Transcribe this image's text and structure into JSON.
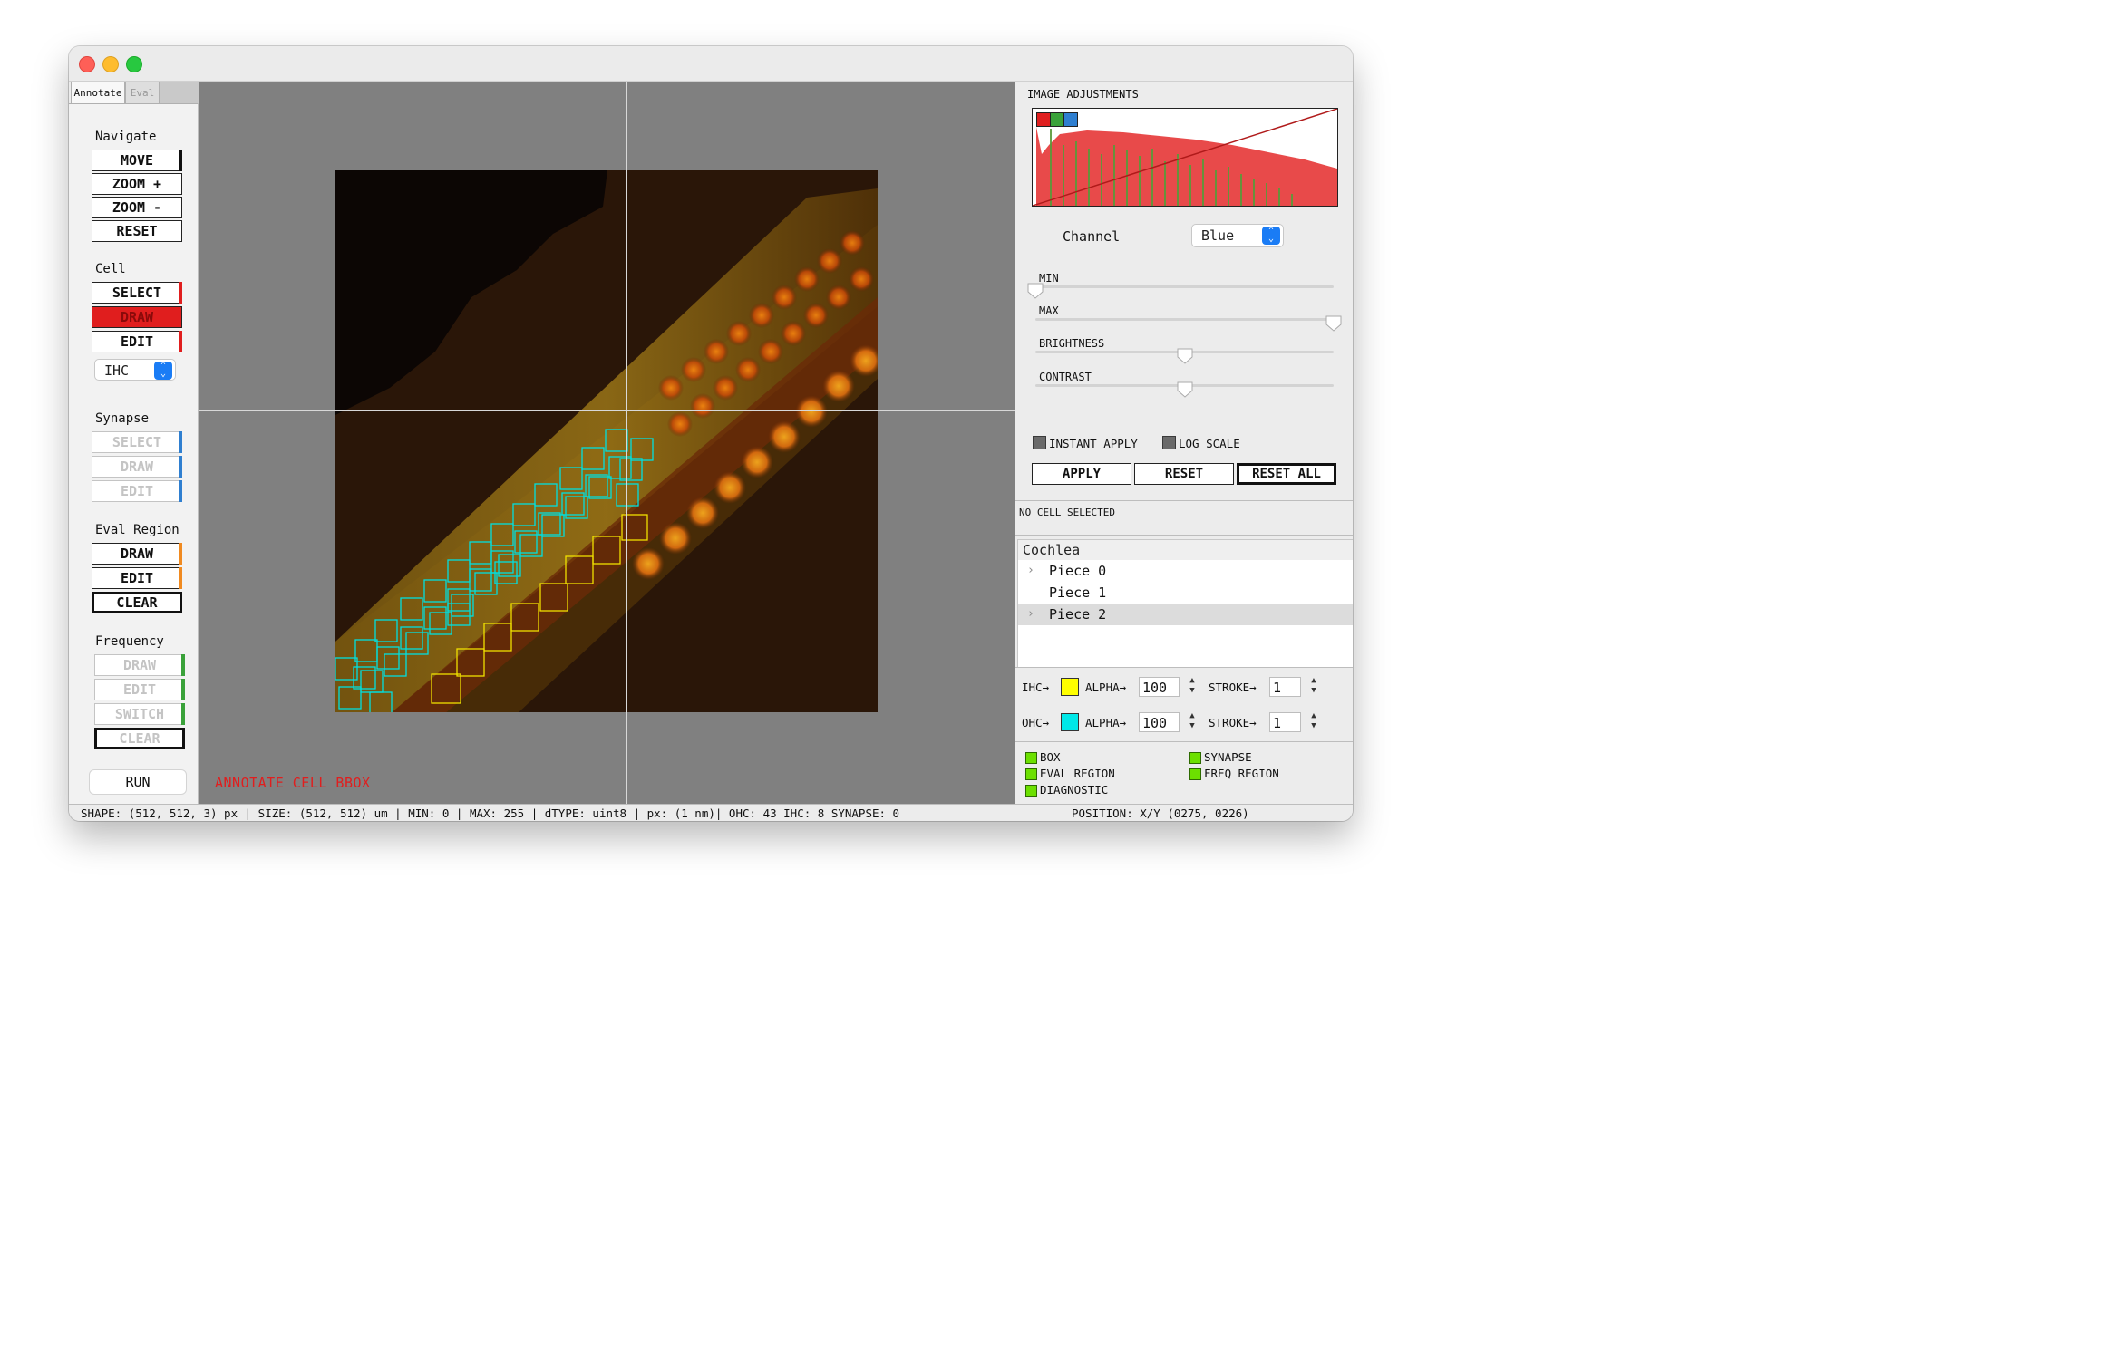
{
  "window": {
    "title": ""
  },
  "tabs": [
    {
      "label": "Annotate",
      "active": true
    },
    {
      "label": "Eval",
      "active": false
    }
  ],
  "navigate": {
    "title": "Navigate",
    "buttons": [
      "MOVE",
      "ZOOM +",
      "ZOOM -",
      "RESET"
    ]
  },
  "cell": {
    "title": "Cell",
    "buttons": [
      "SELECT",
      "DRAW",
      "EDIT"
    ],
    "active": "DRAW",
    "type_select": "IHC"
  },
  "synapse": {
    "title": "Synapse",
    "buttons": [
      "SELECT",
      "DRAW",
      "EDIT"
    ],
    "disabled": true
  },
  "eval_region": {
    "title": "Eval Region",
    "buttons": [
      "DRAW",
      "EDIT",
      "CLEAR"
    ]
  },
  "frequency": {
    "title": "Frequency",
    "buttons": [
      "DRAW",
      "EDIT",
      "SWITCH",
      "CLEAR"
    ],
    "disabled": true
  },
  "run_label": "RUN",
  "canvas": {
    "mode_label": "ANNOTATE CELL BBOX"
  },
  "image_adjustments": {
    "title": "IMAGE ADJUSTMENTS",
    "channel_label": "Channel",
    "channel_value": "Blue",
    "channel_chips": [
      "#e02020",
      "#3aa23a",
      "#2f7fd0"
    ],
    "sliders": [
      {
        "label": "MIN",
        "value": 0
      },
      {
        "label": "MAX",
        "value": 1
      },
      {
        "label": "BRIGHTNESS",
        "value": 0.5
      },
      {
        "label": "CONTRAST",
        "value": 0.5
      }
    ],
    "instant_apply": "INSTANT APPLY",
    "log_scale": "LOG SCALE",
    "apply": "APPLY",
    "reset": "RESET",
    "reset_all": "RESET ALL"
  },
  "selection": {
    "status": "NO CELL SELECTED"
  },
  "tree": {
    "root": "Cochlea",
    "items": [
      {
        "label": "Piece 0",
        "expandable": true,
        "selected": false
      },
      {
        "label": "Piece 1",
        "expandable": false,
        "selected": false
      },
      {
        "label": "Piece 2",
        "expandable": true,
        "selected": true
      }
    ]
  },
  "styles": {
    "ihc": {
      "label": "IHC→",
      "color": "#ffff00",
      "alpha_label": "ALPHA→",
      "alpha": "100",
      "stroke_label": "STROKE→",
      "stroke": "1"
    },
    "ohc": {
      "label": "OHC→",
      "color": "#00e8e8",
      "alpha_label": "ALPHA→",
      "alpha": "100",
      "stroke_label": "STROKE→",
      "stroke": "1"
    }
  },
  "legend": [
    "BOX",
    "SYNAPSE",
    "EVAL REGION",
    "FREQ REGION",
    "DIAGNOSTIC"
  ],
  "status": {
    "left": "SHAPE: (512, 512, 3) px | SIZE: (512, 512) um | MIN: 0 | MAX: 255 | dTYPE: uint8 | px: (1 nm)| OHC: 43 IHC: 8 SYNAPSE: 0",
    "right": "POSITION: X/Y (0275, 0226)"
  }
}
